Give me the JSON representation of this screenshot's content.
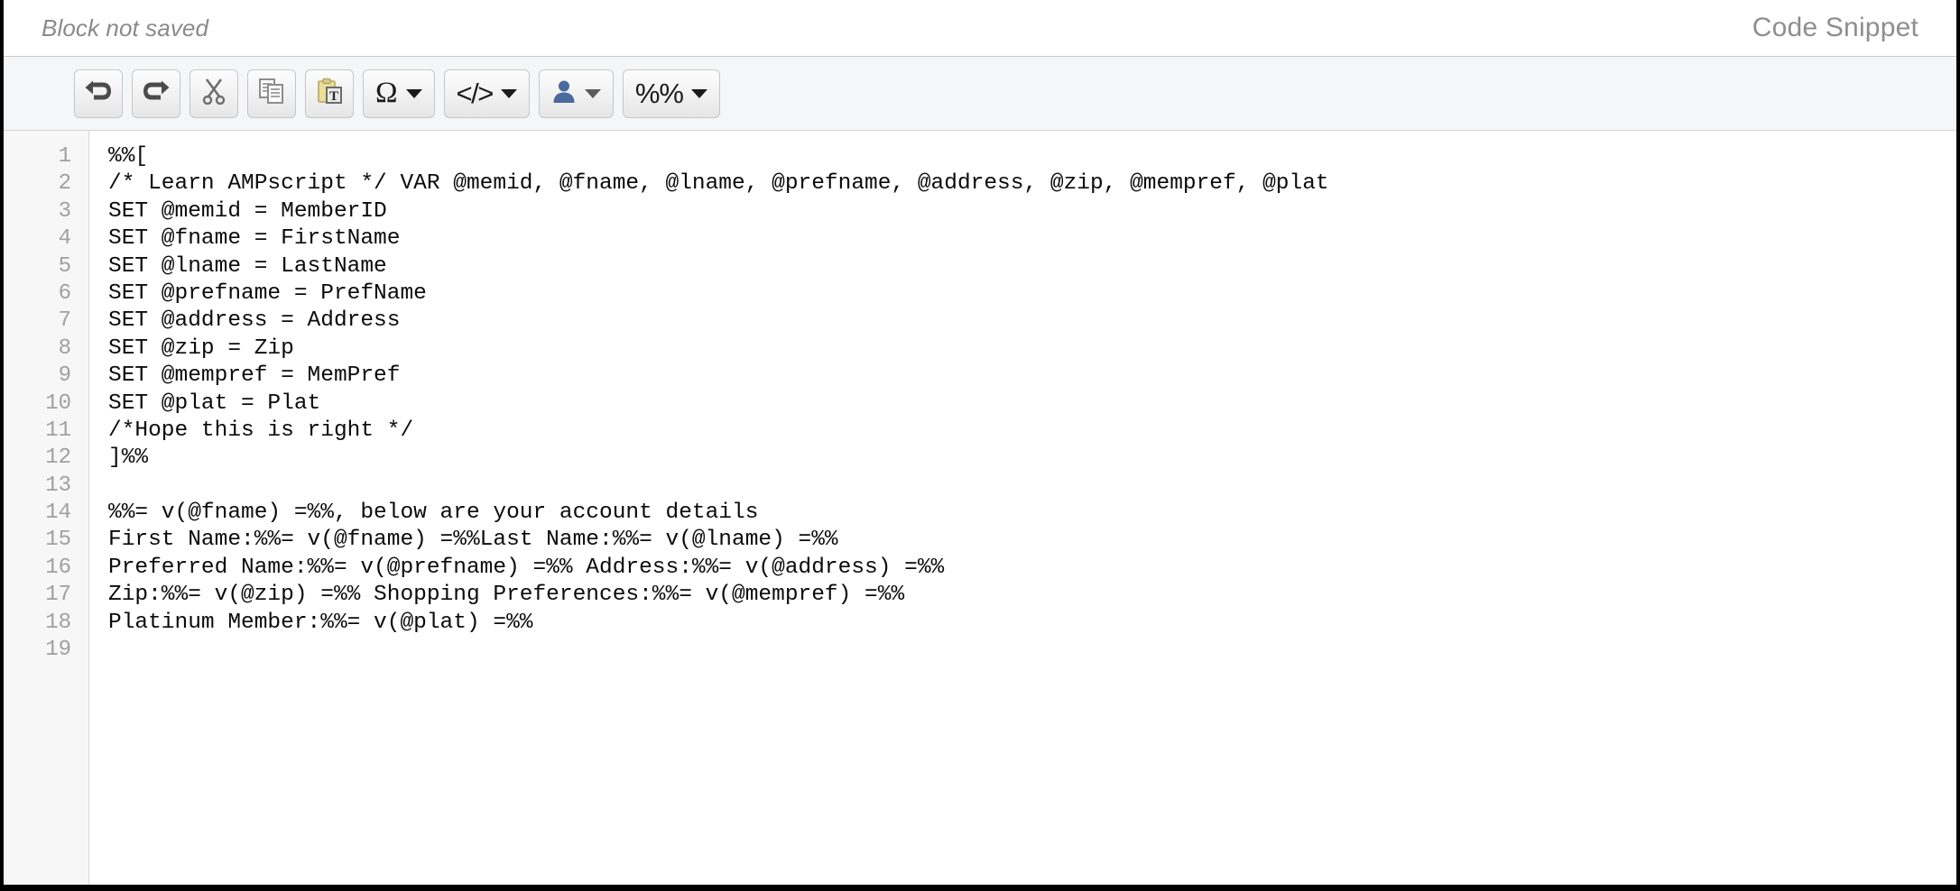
{
  "header": {
    "status_text": "Block not saved",
    "title": "Code Snippet"
  },
  "toolbar": {
    "buttons": [
      {
        "name": "undo",
        "label": "",
        "icon": "undo-arrow-icon",
        "has_caret": false
      },
      {
        "name": "redo",
        "label": "",
        "icon": "redo-arrow-icon",
        "has_caret": false
      },
      {
        "name": "cut",
        "label": "",
        "icon": "scissors-icon",
        "has_caret": false
      },
      {
        "name": "copy",
        "label": "",
        "icon": "copy-documents-icon",
        "has_caret": false
      },
      {
        "name": "paste-as-text",
        "label": "",
        "icon": "clipboard-text-icon",
        "has_caret": false
      },
      {
        "name": "special-characters",
        "label": "Ω",
        "icon": "omega-icon",
        "has_caret": true
      },
      {
        "name": "source-code",
        "label": "</>",
        "icon": "code-brackets-icon",
        "has_caret": true
      },
      {
        "name": "personalization",
        "label": "",
        "icon": "person-icon",
        "has_caret": true
      },
      {
        "name": "ampscript",
        "label": "%%",
        "icon": "percent-percent-icon",
        "has_caret": true
      }
    ]
  },
  "editor": {
    "line_numbers": [
      "1",
      "2",
      "3",
      "4",
      "5",
      "6",
      "7",
      "8",
      "9",
      "10",
      "11",
      "12",
      "13",
      "14",
      "15",
      "16",
      "17",
      "18",
      "19"
    ],
    "lines": [
      "%%[",
      "/* Learn AMPscript */ VAR @memid, @fname, @lname, @prefname, @address, @zip, @mempref, @plat",
      "SET @memid = MemberID",
      "SET @fname = FirstName",
      "SET @lname = LastName",
      "SET @prefname = PrefName",
      "SET @address = Address",
      "SET @zip = Zip",
      "SET @mempref = MemPref",
      "SET @plat = Plat",
      "/*Hope this is right */",
      "]%%",
      "",
      "%%= v(@fname) =%%, below are your account details",
      "First Name:%%= v(@fname) =%%Last Name:%%= v(@lname) =%%",
      "Preferred Name:%%= v(@prefname) =%% Address:%%= v(@address) =%%",
      "Zip:%%= v(@zip) =%% Shopping Preferences:%%= v(@mempref) =%%",
      "Platinum Member:%%= v(@plat) =%%",
      ""
    ]
  },
  "colors": {
    "toolbar_bg": "#f5f6f7",
    "gutter_bg": "#f7f7f7",
    "line_number": "#a0a0a0",
    "code_text": "#0b0b0b",
    "header_text": "#8a8a8a",
    "person_icon": "#4a6a9e",
    "clipboard_yellow": "#e8d98a"
  }
}
